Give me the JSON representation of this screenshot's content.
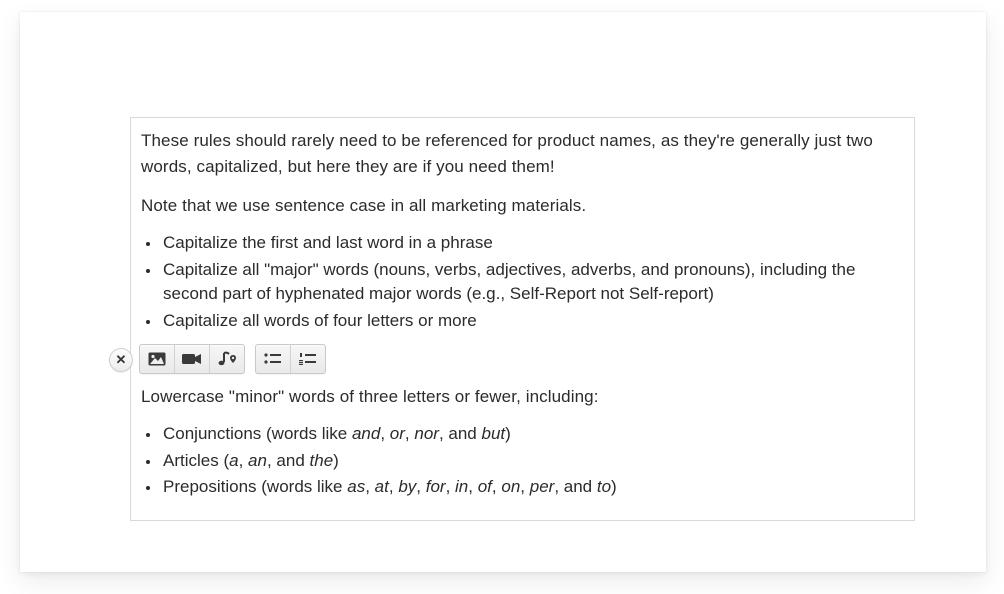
{
  "content": {
    "intro": "These rules should rarely need to be referenced for product names, as they're generally just two words, capitalized, but here they are if you need them!",
    "note": "Note that we use sentence case in all marketing materials.",
    "rules": [
      "Capitalize the first and last word in a phrase",
      "Capitalize all \"major\" words (nouns, verbs, adjectives, adverbs, and pronouns), including the second part of hyphenated major words (e.g., Self-Report not Self-report)",
      "Capitalize all words of four letters or more"
    ],
    "lowercase_heading": "Lowercase \"minor\" words of three letters or fewer, including:",
    "lowercase_items_html": [
      "Conjunctions (words like <em class=\"it\">and</em>, <em class=\"it\">or</em>, <em class=\"it\">nor</em>, and <em class=\"it\">but</em>)",
      "Articles (<em class=\"it\">a</em>, <em class=\"it\">an</em>, and <em class=\"it\">the</em>)",
      "Prepositions (words like <em class=\"it\">as</em>, <em class=\"it\">at</em>, <em class=\"it\">by</em>, <em class=\"it\">for</em>, <em class=\"it\">in</em>, <em class=\"it\">of</em>, <em class=\"it\">on</em>, <em class=\"it\">per</em>, and <em class=\"it\">to</em>)"
    ]
  },
  "toolbar": {
    "close_glyph": "✕",
    "buttons": {
      "image": "image-icon",
      "video": "video-icon",
      "audio": "music-location-icon",
      "ul": "unordered-list-icon",
      "ol": "ordered-list-icon"
    }
  }
}
